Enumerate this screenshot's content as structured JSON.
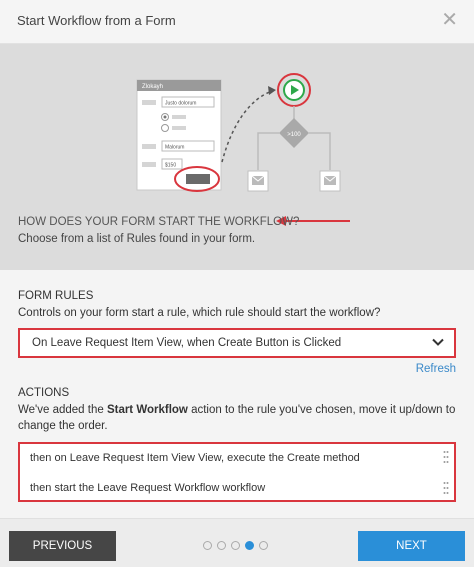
{
  "window": {
    "title": "Start Workflow from a Form"
  },
  "hero": {
    "form_title": "Zlokayh",
    "field1_value": "Justo dolorum",
    "field2_value": "Malorum",
    "field3_value": "$150",
    "diamond_label": ">100",
    "question": "HOW DOES YOUR FORM START THE WORKFLOW?",
    "subtext": "Choose from a list of Rules found in your form."
  },
  "form_rules": {
    "label": "FORM RULES",
    "description": "Controls on your form start a rule, which rule should start the workflow?",
    "selected": "On Leave Request Item View, when Create Button is Clicked",
    "refresh_label": "Refresh"
  },
  "actions": {
    "label": "ACTIONS",
    "description_before": "We've added the ",
    "description_bold": "Start Workflow",
    "description_after": " action to the rule you've chosen, move it up/down to change the order.",
    "items": [
      "then on Leave Request Item View View, execute the Create method",
      "then start the Leave Request Workflow workflow"
    ]
  },
  "footer": {
    "previous_label": "PREVIOUS",
    "next_label": "NEXT",
    "steps_total": 5,
    "active_step": 4
  },
  "colors": {
    "accent": "#2a8fd8",
    "highlight": "#d9363e",
    "play_green": "#2ea84a",
    "dark_button": "#464646"
  }
}
